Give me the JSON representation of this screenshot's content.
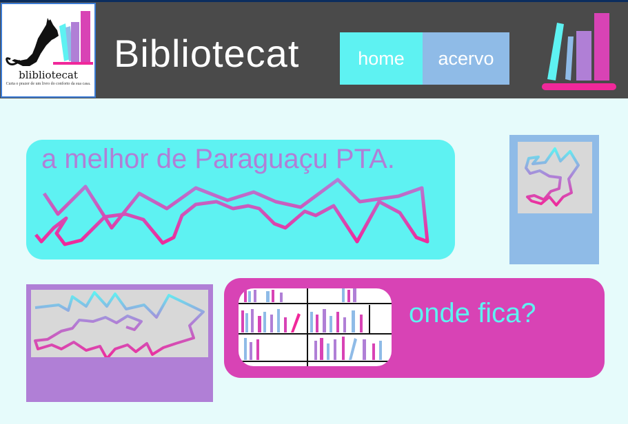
{
  "header": {
    "logo": {
      "name": "blibliotecat",
      "tagline": "Curta o prazer de um livro do conforto da sua casa."
    },
    "title": "Bibliotecat",
    "nav": [
      {
        "label": "home"
      },
      {
        "label": "acervo"
      }
    ],
    "books_icon": "books-icon"
  },
  "hero": {
    "headline": "a melhor de Paraguaçu PTA."
  },
  "info_card": {
    "question": "onde fica?"
  },
  "colors": {
    "header_bg": "#4a4a4a",
    "cyan": "#5ef2f2",
    "light_blue": "#8fbbe7",
    "lavender": "#b07fd6",
    "magenta": "#d843b5",
    "pink": "#f0289a",
    "page_bg": "#e6fbfb"
  }
}
